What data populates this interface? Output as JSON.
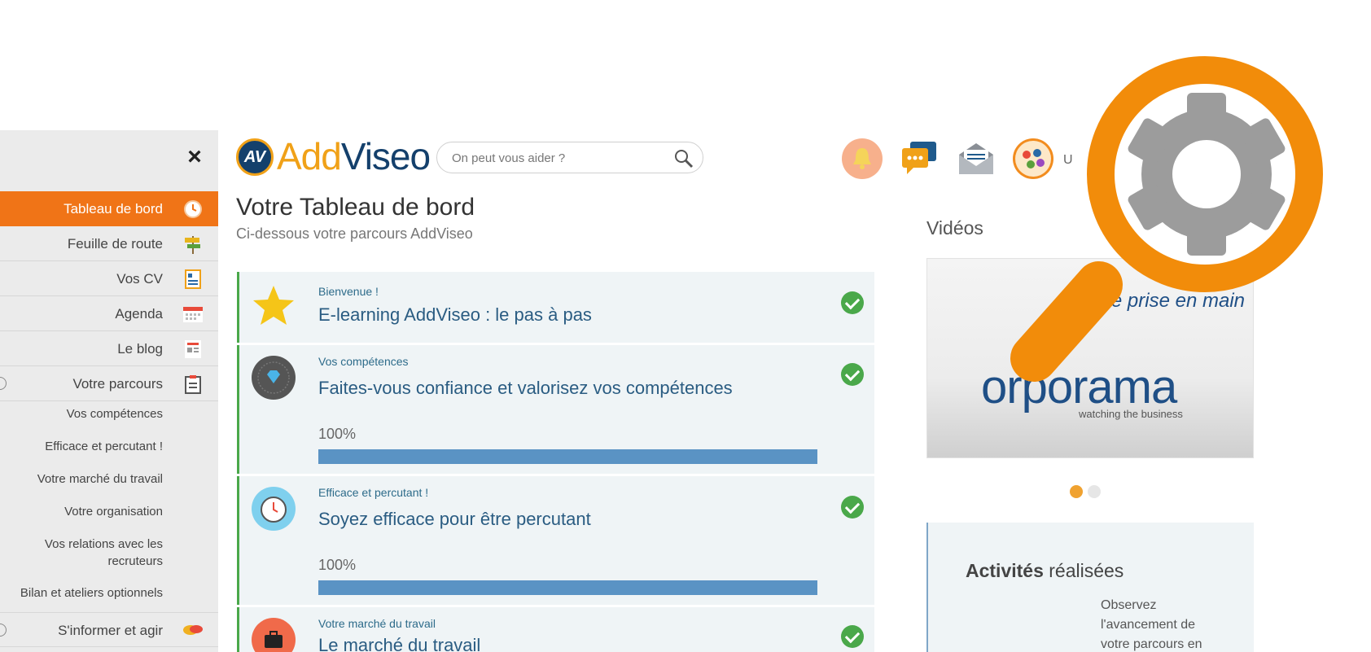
{
  "sidebar": {
    "close_label": "×",
    "items": [
      {
        "label": "Tableau de bord",
        "icon": "dashboard-icon"
      },
      {
        "label": "Feuille de route",
        "icon": "signpost-icon"
      },
      {
        "label": "Vos CV",
        "icon": "cv-icon"
      },
      {
        "label": "Agenda",
        "icon": "calendar-icon"
      },
      {
        "label": "Le blog",
        "icon": "blog-icon"
      },
      {
        "label": "Votre parcours",
        "icon": "clipboard-icon"
      },
      {
        "label": "S'informer et agir",
        "icon": "chat-bubbles-icon"
      }
    ],
    "subitems": [
      "Vos compétences",
      "Efficace et percutant !",
      "Votre marché du travail",
      "Votre organisation",
      "Vos relations avec les recruteurs",
      "Bilan et ateliers optionnels"
    ]
  },
  "header": {
    "logo_a": "Add",
    "logo_b": "Viseo",
    "logo_mark": "AV",
    "search_placeholder": "On peut vous aider ?",
    "user_initial": "U"
  },
  "main": {
    "title": "Votre Tableau de bord",
    "subtitle": "Ci-dessous votre parcours AddViseo",
    "cards": [
      {
        "tag": "Bienvenue !",
        "title": "E-learning AddViseo : le pas à pas",
        "icon": "star-icon"
      },
      {
        "tag": "Vos compétences",
        "title": "Faites-vous confiance et valorisez vos compétences",
        "progress_label": "100%",
        "progress": 1.0,
        "icon": "diamond-icon"
      },
      {
        "tag": "Efficace et percutant !",
        "title": "Soyez efficace pour être percutant",
        "progress_label": "100%",
        "progress": 1.0,
        "icon": "stopwatch-icon"
      },
      {
        "tag": "Votre marché du travail",
        "title": "Le marché du travail",
        "icon": "briefcase-icon"
      }
    ]
  },
  "right": {
    "videos_title": "Vidéos",
    "video_text": "e prise en main",
    "video_brand": "orporama",
    "video_tagline": "watching the business",
    "activities_bold": "Activités",
    "activities_rest": " réalisées",
    "activities_desc": "Observez l'avancement de votre parcours en"
  },
  "colors": {
    "accent": "#f07417",
    "brand_blue": "#14406c",
    "brand_orange": "#f0a118",
    "success": "#4aa84a",
    "progress": "#5a93c4"
  }
}
